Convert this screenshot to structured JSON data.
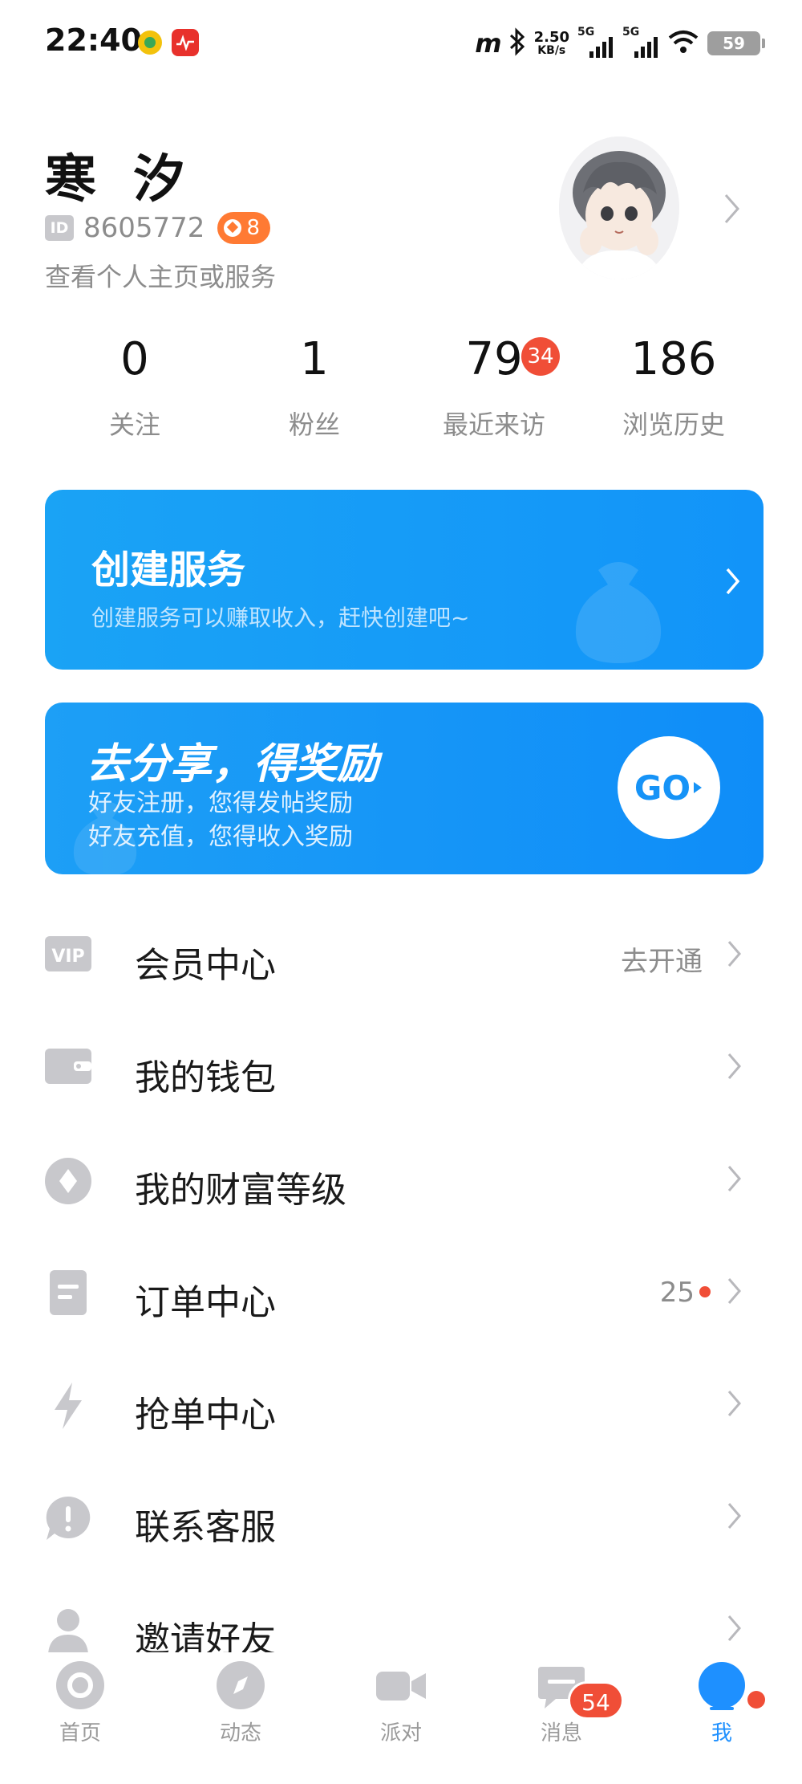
{
  "status_bar": {
    "time": "22:40",
    "carrier_logo": "m",
    "net_speed_value": "2.50",
    "net_speed_unit": "KB/s",
    "sim1_type": "5G",
    "sim2_type": "5G",
    "battery": "59"
  },
  "profile": {
    "name": "寒 汐",
    "id_label": "ID",
    "id_value": "8605772",
    "level": "8",
    "subtitle": "查看个人主页或服务"
  },
  "stats": [
    {
      "value": "0",
      "label": "关注"
    },
    {
      "value": "1",
      "label": "粉丝"
    },
    {
      "value": "79",
      "label": "最近来访",
      "badge": "34"
    },
    {
      "value": "186",
      "label": "浏览历史"
    }
  ],
  "create_banner": {
    "title": "创建服务",
    "description": "创建服务可以赚取收入，赶快创建吧~"
  },
  "share_banner": {
    "title": "去分享，得奖励",
    "line1": "好友注册，您得发帖奖励",
    "line2": "好友充值，您得收入奖励",
    "button": "GO"
  },
  "menu": [
    {
      "icon": "vip-icon",
      "label": "会员中心",
      "value": "去开通"
    },
    {
      "icon": "wallet-icon",
      "label": "我的钱包",
      "value": ""
    },
    {
      "icon": "diamond-icon",
      "label": "我的财富等级",
      "value": ""
    },
    {
      "icon": "order-icon",
      "label": "订单中心",
      "value": "25"
    },
    {
      "icon": "lightning-icon",
      "label": "抢单中心",
      "value": ""
    },
    {
      "icon": "support-icon",
      "label": "联系客服",
      "value": ""
    },
    {
      "icon": "person-icon",
      "label": "邀请好友",
      "value": ""
    }
  ],
  "tabs": [
    {
      "icon": "home-icon",
      "label": "首页"
    },
    {
      "icon": "compass-icon",
      "label": "动态"
    },
    {
      "icon": "video-icon",
      "label": "派对"
    },
    {
      "icon": "message-icon",
      "label": "消息",
      "badge": "54"
    },
    {
      "icon": "me-icon",
      "label": "我",
      "active": true
    }
  ],
  "colors": {
    "accent": "#1e90ff",
    "badge_red": "#f04e37",
    "level_orange": "#ff7a33",
    "icon_gray": "#c8c8cc"
  }
}
